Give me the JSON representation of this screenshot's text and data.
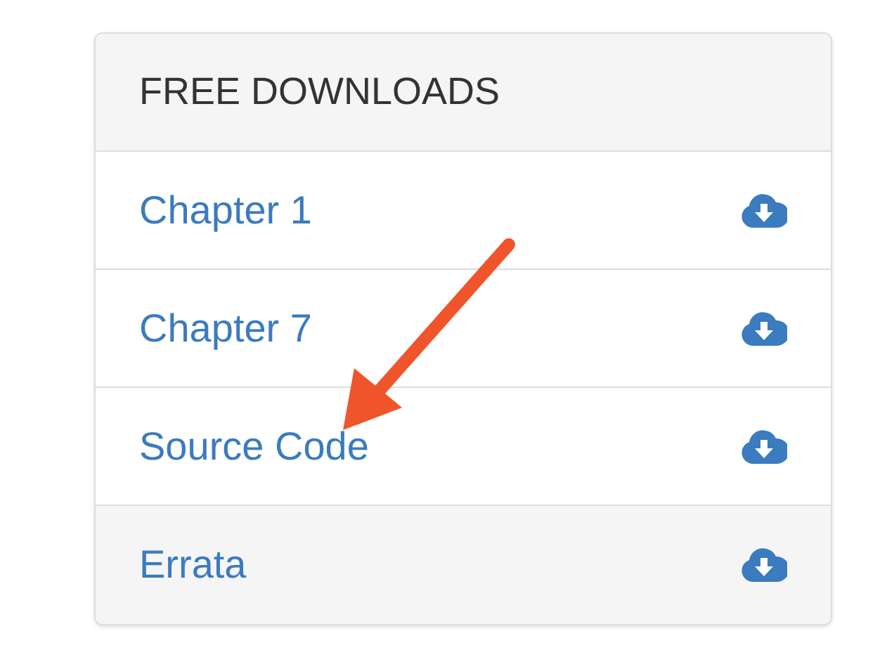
{
  "panel": {
    "title": "FREE DOWNLOADS",
    "items": [
      {
        "label": "Chapter 1",
        "kind": "item"
      },
      {
        "label": "Chapter 7",
        "kind": "item"
      },
      {
        "label": "Source Code",
        "kind": "item"
      },
      {
        "label": "Errata",
        "kind": "footer"
      }
    ]
  }
}
